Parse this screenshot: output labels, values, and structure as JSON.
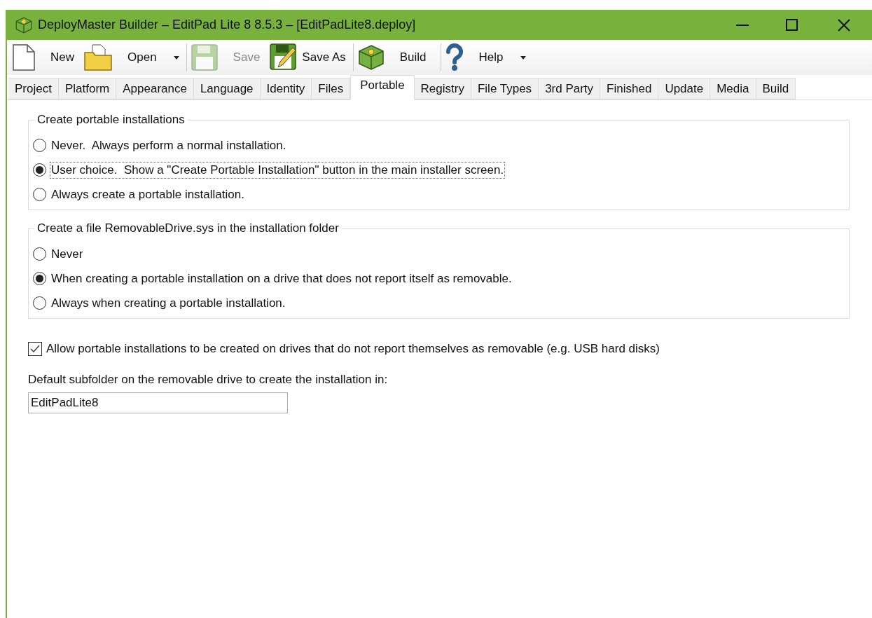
{
  "window": {
    "title": "DeployMaster Builder – EditPad Lite 8 8.5.3 – [EditPadLite8.deploy]"
  },
  "toolbar": [
    {
      "kind": "new",
      "label": "New",
      "disabled": false,
      "dropdown": false
    },
    {
      "kind": "open",
      "label": "Open",
      "disabled": false,
      "dropdown": true
    },
    {
      "kind": "save",
      "label": "Save",
      "disabled": true,
      "dropdown": false
    },
    {
      "kind": "saveas",
      "label": "Save As",
      "disabled": false,
      "dropdown": false
    },
    {
      "kind": "build",
      "label": "Build",
      "disabled": false,
      "dropdown": false
    },
    {
      "kind": "help",
      "label": "Help",
      "disabled": false,
      "dropdown": true
    }
  ],
  "tabs": [
    {
      "label": "Project",
      "selected": false
    },
    {
      "label": "Platform",
      "selected": false
    },
    {
      "label": "Appearance",
      "selected": false
    },
    {
      "label": "Language",
      "selected": false
    },
    {
      "label": "Identity",
      "selected": false
    },
    {
      "label": "Files",
      "selected": false
    },
    {
      "label": "Portable",
      "selected": true
    },
    {
      "label": "Registry",
      "selected": false
    },
    {
      "label": "File Types",
      "selected": false
    },
    {
      "label": "3rd Party",
      "selected": false
    },
    {
      "label": "Finished",
      "selected": false
    },
    {
      "label": "Update",
      "selected": false
    },
    {
      "label": "Media",
      "selected": false
    },
    {
      "label": "Build",
      "selected": false
    }
  ],
  "groups": [
    {
      "title": "Create portable installations",
      "options": [
        {
          "label": "Never.  Always perform a normal installation.",
          "selected": false
        },
        {
          "label": "User choice.  Show a \"Create Portable Installation\" button in the main installer screen.",
          "selected": true
        },
        {
          "label": "Always create a portable installation.",
          "selected": false
        }
      ]
    },
    {
      "title": "Create a file RemovableDrive.sys in the installation folder",
      "options": [
        {
          "label": "Never",
          "selected": false
        },
        {
          "label": "When creating a portable installation on a drive that does not report itself as removable.",
          "selected": true
        },
        {
          "label": "Always when creating a portable installation.",
          "selected": false
        }
      ]
    }
  ],
  "allow_checkbox": {
    "label": "Allow portable installations to be created on drives that do not report themselves as removable (e.g. USB hard disks)",
    "checked": true
  },
  "subfolder": {
    "label": "Default subfolder on the removable drive to create the installation in:",
    "value": "EditPadLite8"
  }
}
